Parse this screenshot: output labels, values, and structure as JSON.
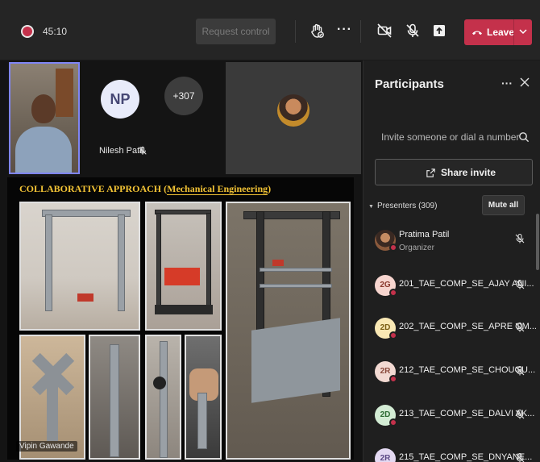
{
  "topbar": {
    "timer": "45:10",
    "request_control": "Request control",
    "leave": "Leave",
    "colors": {
      "leave": "#c4314b",
      "recording": "#c4314b"
    },
    "icons": [
      "recording-icon",
      "hand-raise-icon",
      "more-icon",
      "camera-off-icon",
      "mic-off-icon",
      "share-tray-icon",
      "phone-hangup-icon",
      "chevron-down-icon"
    ]
  },
  "stage": {
    "np_initials": "NP",
    "np_name": "Nilesh Patil",
    "more_count": "+307",
    "slide_title_prefix": "COLLABORATIVE APPROACH (",
    "slide_title_dept": "Mechanical Engineering",
    "slide_title_suffix": ")",
    "presenter_name": "Vipin Gawande"
  },
  "panel": {
    "title": "Participants",
    "invite_placeholder": "Invite someone or dial a number",
    "share_invite": "Share invite",
    "presenters_label": "Presenters (309)",
    "mute_all": "Mute all",
    "participants": [
      {
        "initials": "",
        "name": "Pratima Patil",
        "role": "Organizer"
      },
      {
        "initials": "2G",
        "name": "201_TAE_COMP_SE_AJAY ANI...",
        "role": ""
      },
      {
        "initials": "2D",
        "name": "202_TAE_COMP_SE_APRE OM...",
        "role": ""
      },
      {
        "initials": "2R",
        "name": "212_TAE_COMP_SE_CHOUGU...",
        "role": ""
      },
      {
        "initials": "2D",
        "name": "213_TAE_COMP_SE_DALVI AK...",
        "role": ""
      },
      {
        "initials": "2R",
        "name": "215_TAE_COMP_SE_DNYANE...",
        "role": ""
      }
    ]
  }
}
